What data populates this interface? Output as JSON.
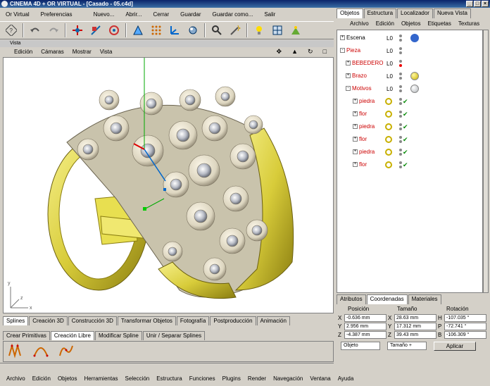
{
  "window": {
    "title": "CINEMA 4D + OR VIRTUAL - [Casado - 05.c4d]"
  },
  "menubar": {
    "items": [
      "Or Virtual",
      "Preferencias",
      "Nuevo...",
      "Abrir...",
      "Cerrar",
      "Guardar",
      "Guardar como...",
      "Salir"
    ]
  },
  "viewport": {
    "header": "Vista",
    "menu": [
      "Edición",
      "Cámaras",
      "Mostrar",
      "Vista"
    ]
  },
  "bottom_tabs": [
    "Splines",
    "Creación 3D",
    "Construcción 3D",
    "Transformar Objetos",
    "Fotografía",
    "Postproducción",
    "Animación"
  ],
  "sub_tabs": [
    "Crear Primitivas",
    "Creación Libre",
    "Modificar Spline",
    "Unir / Separar Splines"
  ],
  "active_sub_tab": "Creación Libre",
  "bottom_menu": [
    "Archivo",
    "Edición",
    "Objetos",
    "Herramientas",
    "Selección",
    "Estructura",
    "Funciones",
    "Plugins",
    "Render",
    "Navegación",
    "Ventana",
    "Ayuda"
  ],
  "right_panel": {
    "tabs": [
      "Objetos",
      "Estructura",
      "Localizador",
      "Nueva Vista"
    ],
    "menu": [
      "Archivo",
      "Edición",
      "Objetos",
      "Etiquetas",
      "Texturas"
    ],
    "objects": [
      {
        "name": "Escena",
        "color": "#000000",
        "expand": "+"
      },
      {
        "name": "Pieza",
        "color": "#cc0000",
        "expand": "-"
      },
      {
        "name": "BEBEDERO",
        "color": "#cc0000",
        "expand": "+"
      },
      {
        "name": "Brazo",
        "color": "#cc0000",
        "expand": "+"
      },
      {
        "name": "Motivos",
        "color": "#cc0000",
        "expand": "-"
      },
      {
        "name": "piedra",
        "color": "#cc0000",
        "expand": "+"
      },
      {
        "name": "flor",
        "color": "#cc0000",
        "expand": "+"
      },
      {
        "name": "piedra",
        "color": "#cc0000",
        "expand": "+"
      },
      {
        "name": "flor",
        "color": "#cc0000",
        "expand": "+"
      },
      {
        "name": "piedra",
        "color": "#cc0000",
        "expand": "+"
      },
      {
        "name": "flor",
        "color": "#cc0000",
        "expand": "+"
      }
    ]
  },
  "attr_panel": {
    "tabs": [
      "Atributos",
      "Coordenadas",
      "Materiales"
    ],
    "headers": [
      "Posición",
      "Tamaño",
      "Rotación"
    ],
    "rows": [
      {
        "pl": "X",
        "pos": "-0.636 mm",
        "sl": "X",
        "size": "28.63 mm",
        "rl": "H",
        "rot": "-107.035 °"
      },
      {
        "pl": "Y",
        "pos": "2.956 mm",
        "sl": "Y",
        "size": "17.312 mm",
        "rl": "P",
        "rot": "-72.741 °"
      },
      {
        "pl": "Z",
        "pos": "-4.387 mm",
        "sl": "Z",
        "size": "39.43 mm",
        "rl": "B",
        "rot": "-106.309 °"
      }
    ],
    "dropdown1": "Objeto",
    "dropdown2": "Tamaño +",
    "apply": "Aplicar"
  }
}
